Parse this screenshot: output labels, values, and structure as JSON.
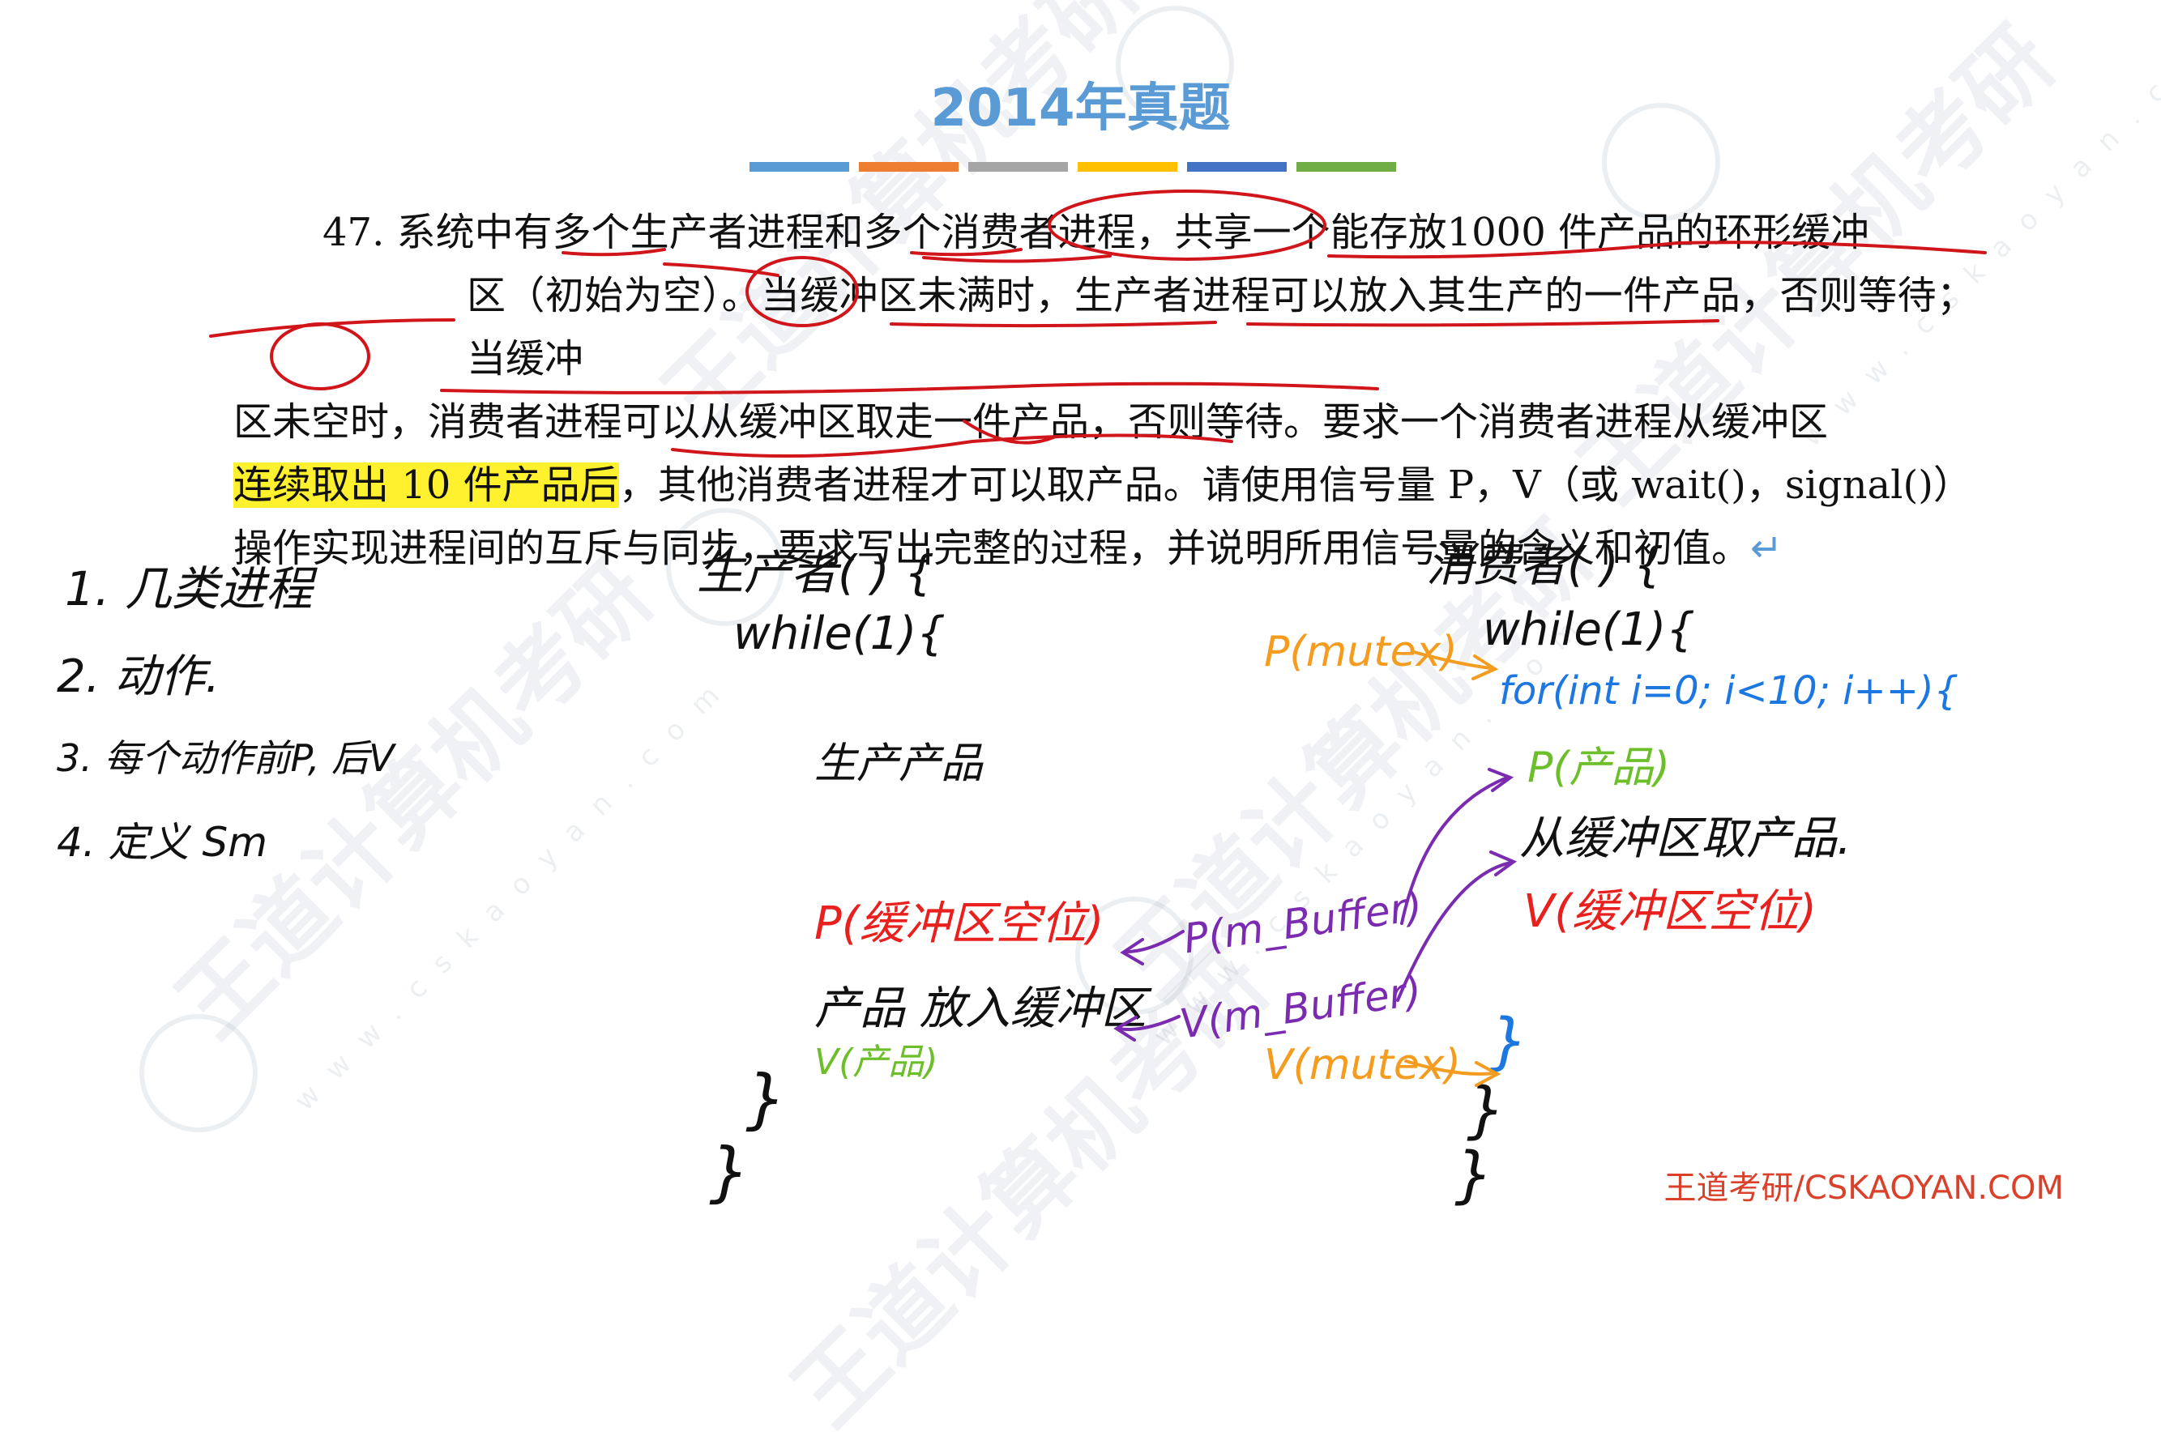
{
  "title": "2014年真题",
  "accent_bars": [
    "#5b9bd5",
    "#ed7d31",
    "#a5a5a5",
    "#ffc000",
    "#4472c4",
    "#70ad47"
  ],
  "problem": {
    "number": "47. ",
    "line1": "系统中有多个生产者进程和多个消费者进程，共享一个能存放1000 件产品的环形缓冲",
    "line2": "区（初始为空）。当缓冲区未满时，生产者进程可以放入其生产的一件产品，否则等待；当缓冲",
    "line3": "区未空时，消费者进程可以从缓冲区取走一件产品，否则等待。要求一个消费者进程从缓冲区",
    "line4_highlight": "连续取出 10 件产品后",
    "line4_rest": "，其他消费者进程才可以取产品。请使用信号量 P，V（或 wait()，signal()）",
    "line5": "操作实现进程间的互斥与同步，要求写出完整的过程，并说明所用信号量的含义和初值。",
    "return_mark": "↵"
  },
  "footer": "王道考研/CSKAOYAN.COM",
  "watermark": {
    "brand": "王道计算机考研",
    "site": "www.cskaoyan.com"
  },
  "notes": {
    "steps": [
      "1. 几类进程",
      "2. 动作.",
      "3. 每个动作前P, 后V",
      "4. 定义 Sm"
    ],
    "producer_header": "生产者( ) {",
    "producer_while": "while(1){",
    "producer_make": "生产产品",
    "producer_p": "P(缓冲区空位)",
    "producer_put": "产品 放入缓冲区",
    "producer_v": "V(产品)",
    "producer_close1": "}",
    "producer_close2": "}",
    "consumer_header": "消费者( ) {",
    "consumer_while": "while(1){",
    "consumer_pmutex": "P(mutex)",
    "consumer_for": "for(int i=0; i<10; i++){",
    "consumer_p": "P(产品)",
    "consumer_take": "从缓冲区取产品.",
    "consumer_v": "V(缓冲区空位)",
    "consumer_close_for": "}",
    "consumer_vmutex": "V(mutex)",
    "consumer_close_while": "}",
    "consumer_close": "}",
    "p_buffer": "P(m_Buffer)",
    "v_buffer": "V(m_Buffer)"
  }
}
